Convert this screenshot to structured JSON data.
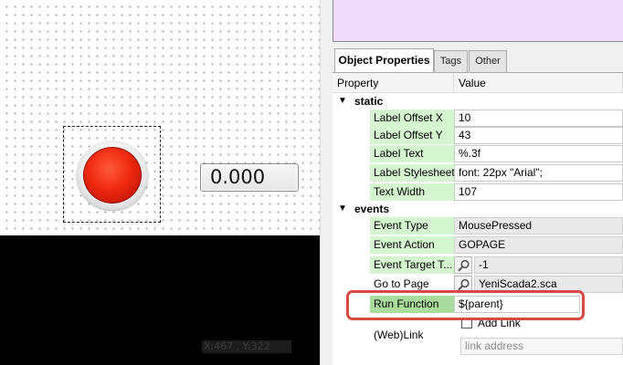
{
  "canvas": {
    "value_display": "0.000",
    "coord_readout": "X:467 , Y:322"
  },
  "tabs": [
    {
      "label": "Object Properties",
      "active": true
    },
    {
      "label": "Tags",
      "active": false
    },
    {
      "label": "Other",
      "active": false
    }
  ],
  "table_headers": {
    "property": "Property",
    "value": "Value"
  },
  "groups": {
    "static": {
      "label": "static",
      "rows": [
        {
          "name": "Label Offset X",
          "value": "10"
        },
        {
          "name": "Label Offset Y",
          "value": "43"
        },
        {
          "name": "Label Text",
          "value": "%.3f"
        },
        {
          "name": "Label Stylesheet",
          "value": "font: 22px \"Arial\";"
        },
        {
          "name": "Text Width",
          "value": "107"
        }
      ]
    },
    "events": {
      "label": "events",
      "rows": [
        {
          "name": "Event Type",
          "value": "MousePressed"
        },
        {
          "name": "Event Action",
          "value": "GOPAGE"
        },
        {
          "name": "Event Target T...",
          "value": "-1"
        },
        {
          "name": "Go to Page",
          "value": "YeniScada2.sca"
        },
        {
          "name": "Run Function",
          "value": "${parent}"
        }
      ]
    }
  },
  "add_link": {
    "label": "Add Link",
    "checked": false
  },
  "web_link": {
    "label": "(Web)Link",
    "placeholder": "link address"
  },
  "colors": {
    "property_bg": "#d4f5cf",
    "run_function_bg": "#a9dc9d",
    "highlight": "#d64a43",
    "top_panel": "#efdcfb"
  }
}
